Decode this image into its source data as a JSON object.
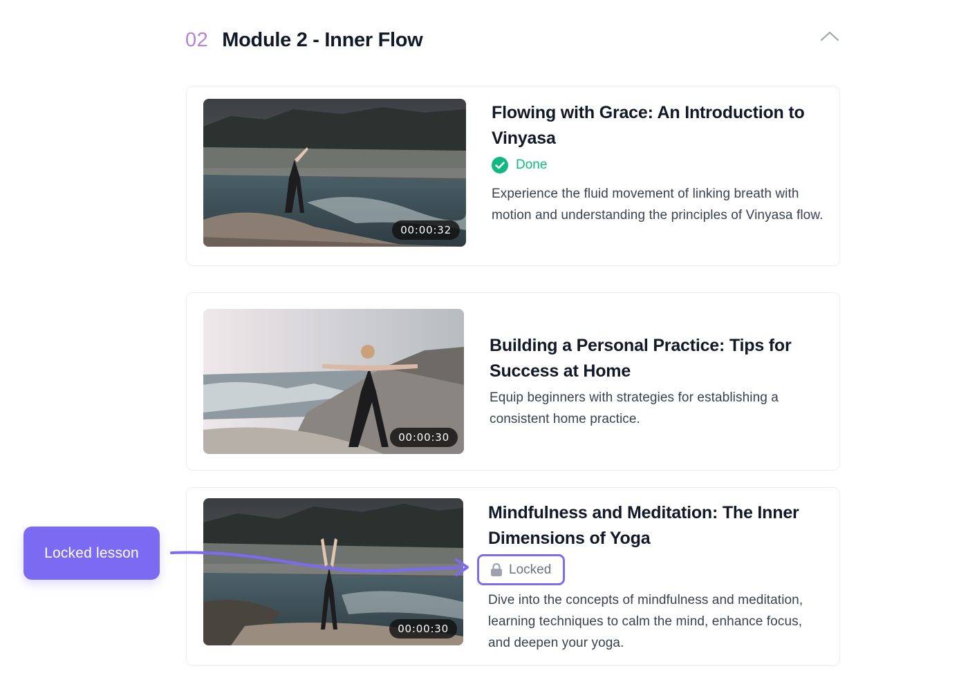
{
  "module": {
    "number": "02",
    "title": "Module 2 - Inner Flow"
  },
  "lessons": [
    {
      "title": "Flowing with Grace: An Introduction to Vinyasa",
      "status": "Done",
      "description": "Experience the fluid movement of linking breath with motion and understanding the principles of Vinyasa flow.",
      "duration": "00:00:32"
    },
    {
      "title": "Building a Personal Practice: Tips for Success at Home",
      "description": "Equip beginners with strategies for establishing a consistent home practice.",
      "duration": "00:00:30"
    },
    {
      "title": "Mindfulness and Meditation: The Inner Dimensions of Yoga",
      "status": "Locked",
      "description": "Dive into the concepts of mindfulness and meditation, learning techniques to calm the mind, enhance focus, and deepen your yoga.",
      "duration": "00:00:30"
    }
  ],
  "callout": {
    "label": "Locked lesson"
  },
  "colors": {
    "accent": "#7b6bf2",
    "module_number": "#b483d6",
    "done": "#10b981",
    "locked_text": "#6b7280"
  },
  "icons": {
    "collapse": "chevron-up-icon",
    "done": "check-circle-icon",
    "locked": "lock-icon",
    "play": "video-thumbnail"
  }
}
